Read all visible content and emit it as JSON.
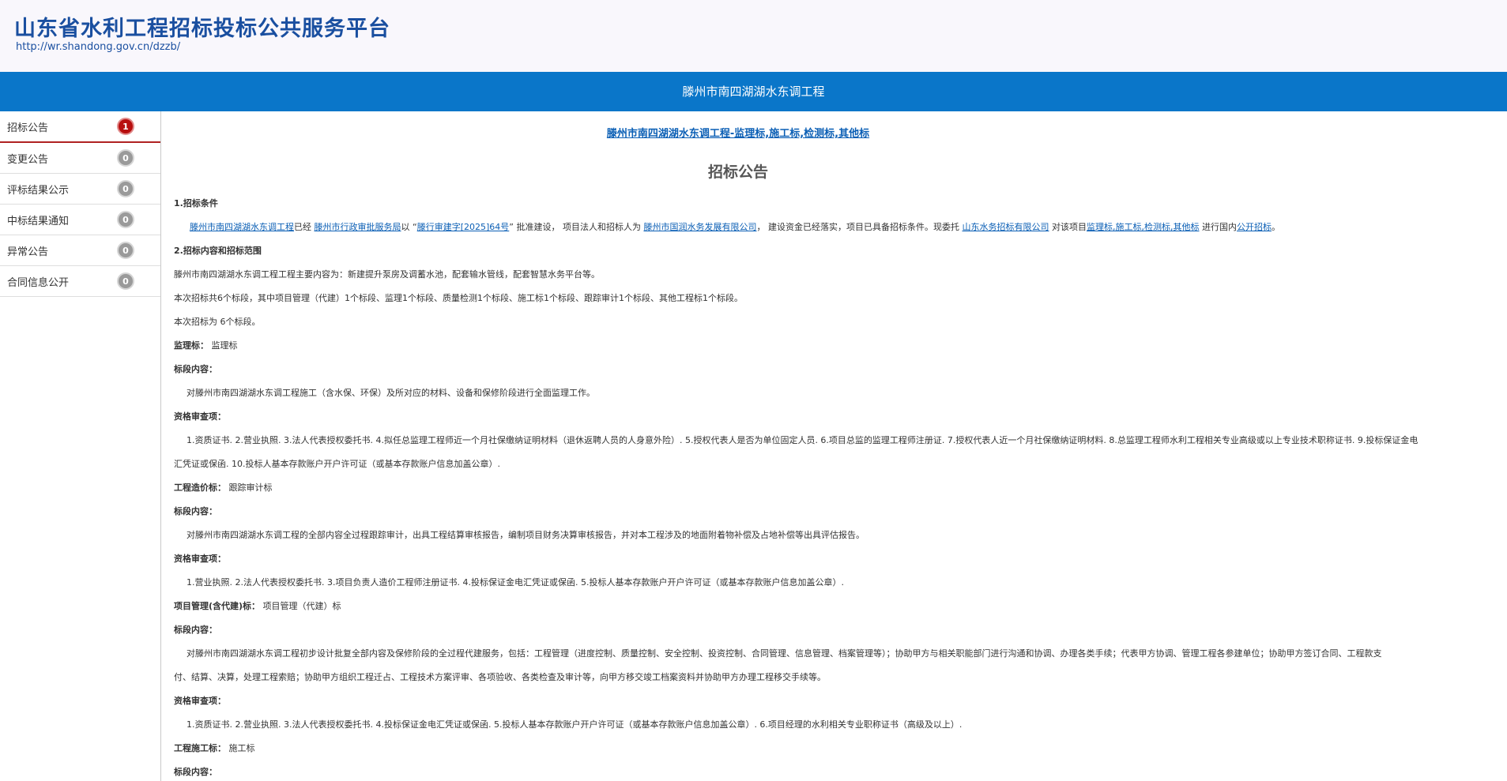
{
  "header": {
    "site_title": "山东省水利工程招标投标公共服务平台",
    "site_url": "http://wr.shandong.gov.cn/dzzb/"
  },
  "banner": {
    "title": "滕州市南四湖湖水东调工程"
  },
  "sidebar": {
    "items": [
      {
        "label": "招标公告",
        "count": "1"
      },
      {
        "label": "变更公告",
        "count": "0"
      },
      {
        "label": "评标结果公示",
        "count": "0"
      },
      {
        "label": "中标结果通知",
        "count": "0"
      },
      {
        "label": "异常公告",
        "count": "0"
      },
      {
        "label": "合同信息公开",
        "count": "0"
      }
    ]
  },
  "main": {
    "project_link": "滕州市南四湖湖水东调工程-监理标,施工标,检测标,其他标",
    "notice_title": "招标公告",
    "sec1_title": "1.招标条件",
    "cond": {
      "project": "滕州市南四湖湖水东调工程",
      "t1": "已经",
      "approver": "滕州市行政审批服务局",
      "t2": "以 “",
      "doc_no": "滕行审建字[2025]64号",
      "t3": "” 批准建设， 项目法人和招标人为",
      "owner": "滕州市国润水务发展有限公司",
      "t4": "， 建设资金已经落实，项目已具备招标条件。现委托",
      "agent": "山东水务招标有限公司",
      "t5": "对该项目",
      "lots": "监理标,施工标,检测标,其他标",
      "t6": "进行国内",
      "method": "公开招标",
      "t7": "。"
    },
    "sec2_title": "2.招标内容和招标范围",
    "scope1": "滕州市南四湖湖水东调工程工程主要内容为：新建提升泵房及调蓄水池，配套输水管线，配套智慧水务平台等。",
    "scope2": "本次招标共6个标段，其中项目管理（代建）1个标段、监理1个标段、质量检测1个标段、施工标1个标段、跟踪审计1个标段、其他工程标1个标段。",
    "scope3": "本次招标为 6个标段。",
    "lot_supervision_label": "监理标：",
    "lot_supervision_value": "监理标",
    "content_label_1": "标段内容：",
    "supervision_content": "对滕州市南四湖湖水东调工程施工（含水保、环保）及所对应的材料、设备和保修阶段进行全面监理工作。",
    "qual_label_1": "资格审查项：",
    "supervision_qual_1": "1.资质证书. 2.营业执照. 3.法人代表授权委托书. 4.拟任总监理工程师近一个月社保缴纳证明材料（退休返聘人员的人身意外险）. 5.授权代表人是否为单位固定人员. 6.项目总监的监理工程师注册证. 7.授权代表人近一个月社保缴纳证明材料. 8.总监理工程师水利工程相关专业高级或以上专业技术职称证书. 9.投标保证金电",
    "supervision_qual_2": "汇凭证或保函. 10.投标人基本存款账户开户许可证（或基本存款账户信息加盖公章）.",
    "lot_cost_label": "工程造价标：",
    "lot_cost_value": "跟踪审计标",
    "content_label_2": "标段内容：",
    "cost_content": "对滕州市南四湖湖水东调工程的全部内容全过程跟踪审计，出具工程结算审核报告，编制项目财务决算审核报告，并对本工程涉及的地面附着物补偿及占地补偿等出具评估报告。",
    "qual_label_2": "资格审查项：",
    "cost_qual": "1.营业执照. 2.法人代表授权委托书. 3.项目负责人造价工程师注册证书. 4.投标保证金电汇凭证或保函. 5.投标人基本存款账户开户许可证（或基本存款账户信息加盖公章）.",
    "lot_pm_label": "项目管理(含代建)标：",
    "lot_pm_value": "项目管理（代建）标",
    "content_label_3": "标段内容：",
    "pm_content_1": "对滕州市南四湖湖水东调工程初步设计批复全部内容及保修阶段的全过程代建服务，包括：工程管理（进度控制、质量控制、安全控制、投资控制、合同管理、信息管理、档案管理等）；协助甲方与相关职能部门进行沟通和协调、办理各类手续；代表甲方协调、管理工程各参建单位；协助甲方签订合同、工程款支",
    "pm_content_2": "付、结算、决算，处理工程索赔；协助甲方组织工程迁占、工程技术方案评审、各项验收、各类检查及审计等，向甲方移交竣工档案资料并协助甲方办理工程移交手续等。",
    "qual_label_3": "资格审查项：",
    "pm_qual": "1.资质证书. 2.营业执照. 3.法人代表授权委托书. 4.投标保证金电汇凭证或保函. 5.投标人基本存款账户开户许可证（或基本存款账户信息加盖公章）. 6.项目经理的水利相关专业职称证书（高级及以上）.",
    "lot_construction_label": "工程施工标：",
    "lot_construction_value": "施工标",
    "content_label_4": "标段内容："
  }
}
